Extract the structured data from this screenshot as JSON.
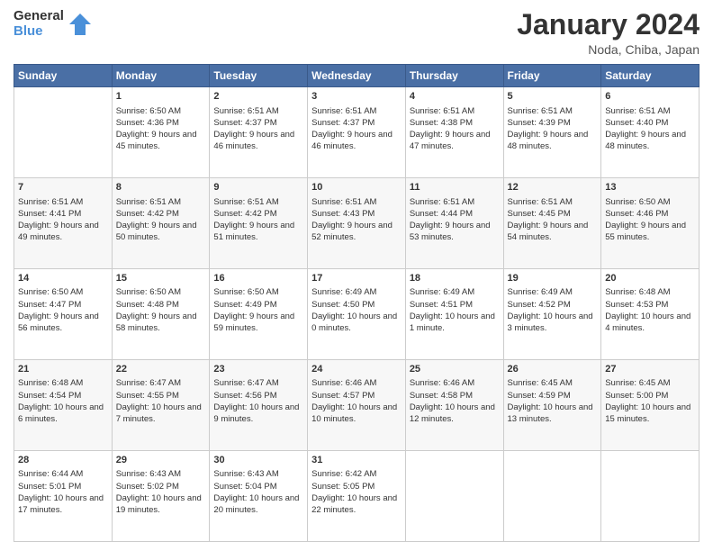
{
  "header": {
    "logo_general": "General",
    "logo_blue": "Blue",
    "month_title": "January 2024",
    "location": "Noda, Chiba, Japan"
  },
  "days_of_week": [
    "Sunday",
    "Monday",
    "Tuesday",
    "Wednesday",
    "Thursday",
    "Friday",
    "Saturday"
  ],
  "weeks": [
    [
      {
        "day": "",
        "sunrise": "",
        "sunset": "",
        "daylight": ""
      },
      {
        "day": "1",
        "sunrise": "Sunrise: 6:50 AM",
        "sunset": "Sunset: 4:36 PM",
        "daylight": "Daylight: 9 hours and 45 minutes."
      },
      {
        "day": "2",
        "sunrise": "Sunrise: 6:51 AM",
        "sunset": "Sunset: 4:37 PM",
        "daylight": "Daylight: 9 hours and 46 minutes."
      },
      {
        "day": "3",
        "sunrise": "Sunrise: 6:51 AM",
        "sunset": "Sunset: 4:37 PM",
        "daylight": "Daylight: 9 hours and 46 minutes."
      },
      {
        "day": "4",
        "sunrise": "Sunrise: 6:51 AM",
        "sunset": "Sunset: 4:38 PM",
        "daylight": "Daylight: 9 hours and 47 minutes."
      },
      {
        "day": "5",
        "sunrise": "Sunrise: 6:51 AM",
        "sunset": "Sunset: 4:39 PM",
        "daylight": "Daylight: 9 hours and 48 minutes."
      },
      {
        "day": "6",
        "sunrise": "Sunrise: 6:51 AM",
        "sunset": "Sunset: 4:40 PM",
        "daylight": "Daylight: 9 hours and 48 minutes."
      }
    ],
    [
      {
        "day": "7",
        "sunrise": "Sunrise: 6:51 AM",
        "sunset": "Sunset: 4:41 PM",
        "daylight": "Daylight: 9 hours and 49 minutes."
      },
      {
        "day": "8",
        "sunrise": "Sunrise: 6:51 AM",
        "sunset": "Sunset: 4:42 PM",
        "daylight": "Daylight: 9 hours and 50 minutes."
      },
      {
        "day": "9",
        "sunrise": "Sunrise: 6:51 AM",
        "sunset": "Sunset: 4:42 PM",
        "daylight": "Daylight: 9 hours and 51 minutes."
      },
      {
        "day": "10",
        "sunrise": "Sunrise: 6:51 AM",
        "sunset": "Sunset: 4:43 PM",
        "daylight": "Daylight: 9 hours and 52 minutes."
      },
      {
        "day": "11",
        "sunrise": "Sunrise: 6:51 AM",
        "sunset": "Sunset: 4:44 PM",
        "daylight": "Daylight: 9 hours and 53 minutes."
      },
      {
        "day": "12",
        "sunrise": "Sunrise: 6:51 AM",
        "sunset": "Sunset: 4:45 PM",
        "daylight": "Daylight: 9 hours and 54 minutes."
      },
      {
        "day": "13",
        "sunrise": "Sunrise: 6:50 AM",
        "sunset": "Sunset: 4:46 PM",
        "daylight": "Daylight: 9 hours and 55 minutes."
      }
    ],
    [
      {
        "day": "14",
        "sunrise": "Sunrise: 6:50 AM",
        "sunset": "Sunset: 4:47 PM",
        "daylight": "Daylight: 9 hours and 56 minutes."
      },
      {
        "day": "15",
        "sunrise": "Sunrise: 6:50 AM",
        "sunset": "Sunset: 4:48 PM",
        "daylight": "Daylight: 9 hours and 58 minutes."
      },
      {
        "day": "16",
        "sunrise": "Sunrise: 6:50 AM",
        "sunset": "Sunset: 4:49 PM",
        "daylight": "Daylight: 9 hours and 59 minutes."
      },
      {
        "day": "17",
        "sunrise": "Sunrise: 6:49 AM",
        "sunset": "Sunset: 4:50 PM",
        "daylight": "Daylight: 10 hours and 0 minutes."
      },
      {
        "day": "18",
        "sunrise": "Sunrise: 6:49 AM",
        "sunset": "Sunset: 4:51 PM",
        "daylight": "Daylight: 10 hours and 1 minute."
      },
      {
        "day": "19",
        "sunrise": "Sunrise: 6:49 AM",
        "sunset": "Sunset: 4:52 PM",
        "daylight": "Daylight: 10 hours and 3 minutes."
      },
      {
        "day": "20",
        "sunrise": "Sunrise: 6:48 AM",
        "sunset": "Sunset: 4:53 PM",
        "daylight": "Daylight: 10 hours and 4 minutes."
      }
    ],
    [
      {
        "day": "21",
        "sunrise": "Sunrise: 6:48 AM",
        "sunset": "Sunset: 4:54 PM",
        "daylight": "Daylight: 10 hours and 6 minutes."
      },
      {
        "day": "22",
        "sunrise": "Sunrise: 6:47 AM",
        "sunset": "Sunset: 4:55 PM",
        "daylight": "Daylight: 10 hours and 7 minutes."
      },
      {
        "day": "23",
        "sunrise": "Sunrise: 6:47 AM",
        "sunset": "Sunset: 4:56 PM",
        "daylight": "Daylight: 10 hours and 9 minutes."
      },
      {
        "day": "24",
        "sunrise": "Sunrise: 6:46 AM",
        "sunset": "Sunset: 4:57 PM",
        "daylight": "Daylight: 10 hours and 10 minutes."
      },
      {
        "day": "25",
        "sunrise": "Sunrise: 6:46 AM",
        "sunset": "Sunset: 4:58 PM",
        "daylight": "Daylight: 10 hours and 12 minutes."
      },
      {
        "day": "26",
        "sunrise": "Sunrise: 6:45 AM",
        "sunset": "Sunset: 4:59 PM",
        "daylight": "Daylight: 10 hours and 13 minutes."
      },
      {
        "day": "27",
        "sunrise": "Sunrise: 6:45 AM",
        "sunset": "Sunset: 5:00 PM",
        "daylight": "Daylight: 10 hours and 15 minutes."
      }
    ],
    [
      {
        "day": "28",
        "sunrise": "Sunrise: 6:44 AM",
        "sunset": "Sunset: 5:01 PM",
        "daylight": "Daylight: 10 hours and 17 minutes."
      },
      {
        "day": "29",
        "sunrise": "Sunrise: 6:43 AM",
        "sunset": "Sunset: 5:02 PM",
        "daylight": "Daylight: 10 hours and 19 minutes."
      },
      {
        "day": "30",
        "sunrise": "Sunrise: 6:43 AM",
        "sunset": "Sunset: 5:04 PM",
        "daylight": "Daylight: 10 hours and 20 minutes."
      },
      {
        "day": "31",
        "sunrise": "Sunrise: 6:42 AM",
        "sunset": "Sunset: 5:05 PM",
        "daylight": "Daylight: 10 hours and 22 minutes."
      },
      {
        "day": "",
        "sunrise": "",
        "sunset": "",
        "daylight": ""
      },
      {
        "day": "",
        "sunrise": "",
        "sunset": "",
        "daylight": ""
      },
      {
        "day": "",
        "sunrise": "",
        "sunset": "",
        "daylight": ""
      }
    ]
  ]
}
